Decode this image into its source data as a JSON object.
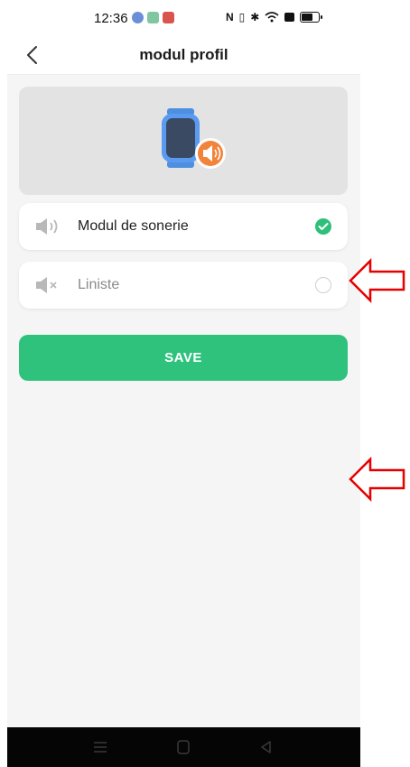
{
  "status_bar": {
    "time": "12:36",
    "app_icon_colors": [
      "#6a8fd8",
      "#7fc7a0",
      "#d9534f"
    ]
  },
  "header": {
    "title": "modul profil",
    "back_icon": "chevron-left-icon"
  },
  "device": {
    "icon": "watch-with-speaker-icon"
  },
  "options": [
    {
      "label": "Modul de sonerie",
      "icon": "speaker-sound-icon",
      "selected": true
    },
    {
      "label": "Liniste",
      "icon": "speaker-mute-icon",
      "selected": false
    }
  ],
  "save_button": {
    "label": "SAVE"
  },
  "colors": {
    "accent": "#2fc27c",
    "annotation_arrow": "#e60000"
  }
}
